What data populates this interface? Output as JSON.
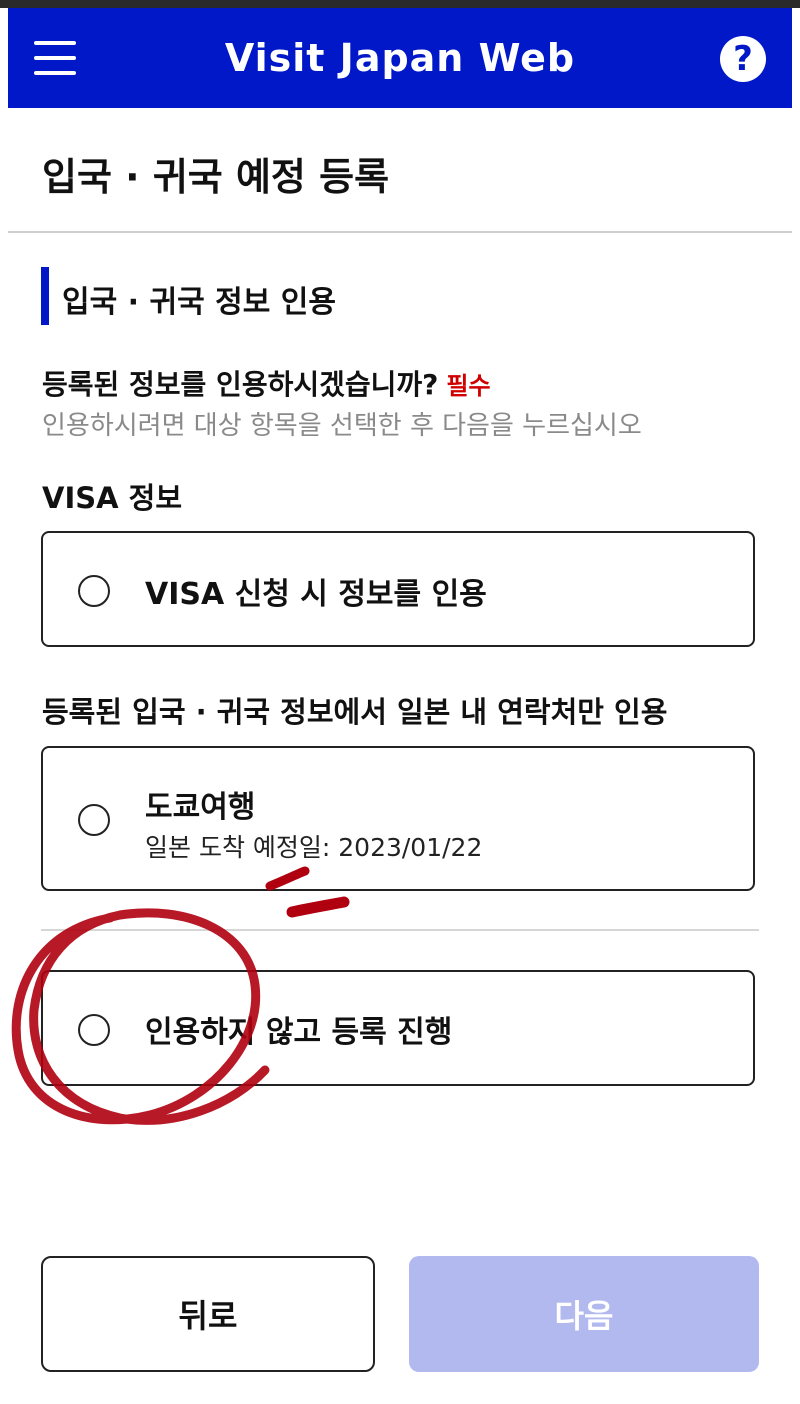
{
  "header": {
    "title": "Visit Japan Web",
    "help_symbol": "?"
  },
  "page": {
    "title": "입국 · 귀국 예정 등록"
  },
  "section": {
    "title": "입국 · 귀국 정보 인용",
    "question": "등록된 정보를 인용하시겠습니까?",
    "required_badge": "필수",
    "hint": "인용하시려면 대상 항목을 선택한 후 다음을 누르십시오"
  },
  "visa_group": {
    "label": "VISA 정보",
    "option_label": "VISA 신청 시 정보를 인용"
  },
  "contact_group": {
    "label": "등록된 입국 · 귀국 정보에서 일본 내 연락처만 인용",
    "option_label": "도쿄여행",
    "option_sub": "일본 도착 예정일: 2023/01/22"
  },
  "no_cite_option": {
    "label": "인용하지 않고 등록 진행"
  },
  "buttons": {
    "back": "뒤로",
    "next": "다음"
  },
  "colors": {
    "brand_blue": "#0018c8",
    "required_red": "#d00000",
    "disabled_next": "#b2b9ee",
    "annotation_red": "#b00010"
  },
  "icons": [
    "hamburger-menu-icon",
    "help-icon",
    "radio-unchecked-icon"
  ]
}
